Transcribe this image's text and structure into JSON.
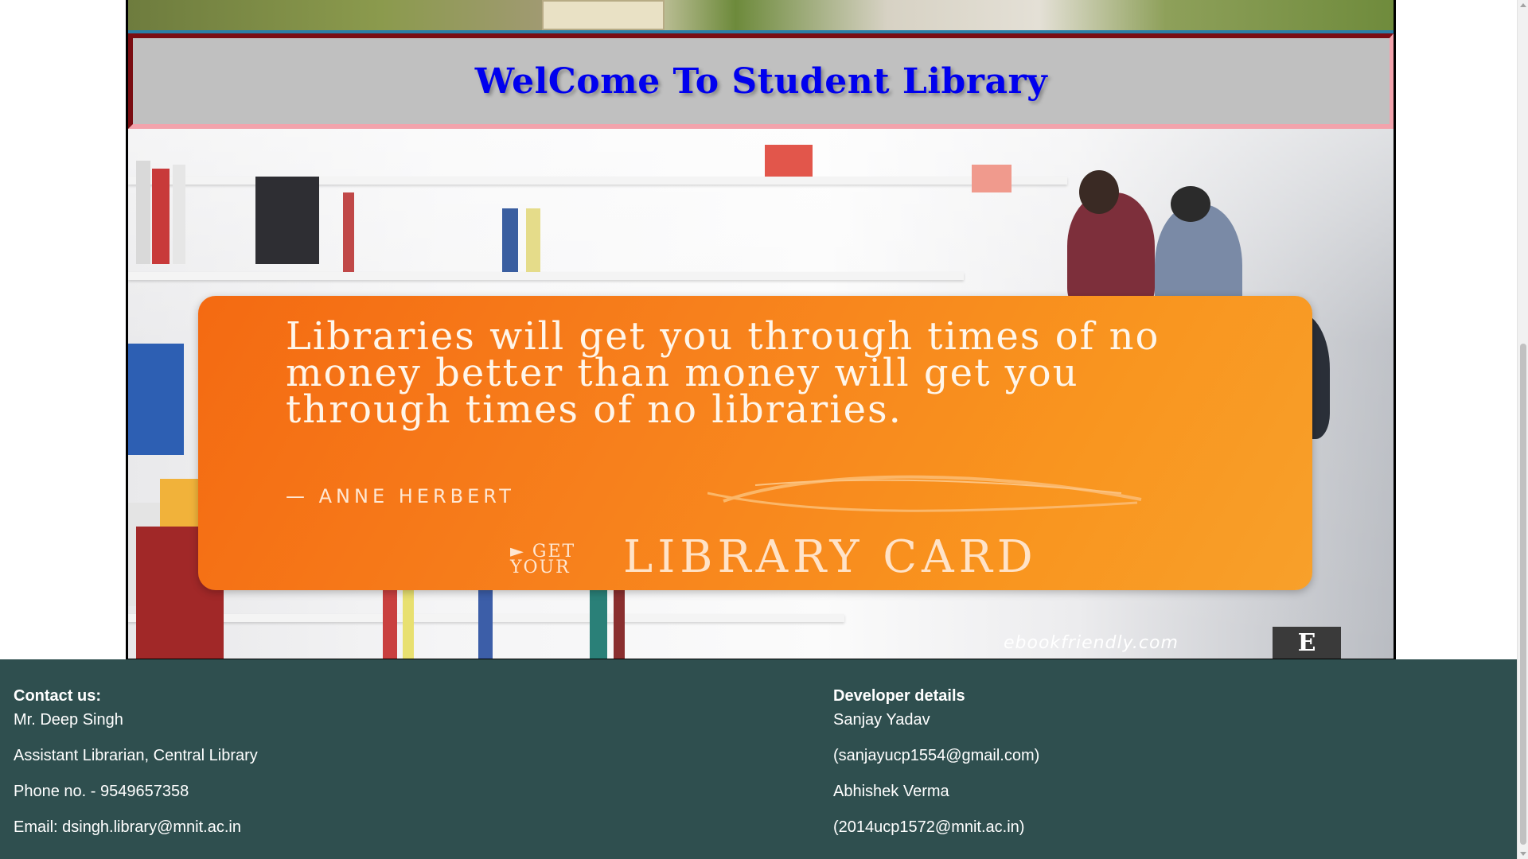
{
  "header": {
    "title": "WelCome To Student Library"
  },
  "poster": {
    "quote": "Libraries will get you through times of no money better than money will get you through times of no libraries.",
    "author": "— ANNE HERBERT",
    "cta_prefix_line1": "► GET",
    "cta_prefix_line2": "YOUR",
    "cta_main": "LIBRARY CARD",
    "site": "ebookfriendly.com",
    "logo_letter": "E"
  },
  "footer": {
    "contact": {
      "heading": "Contact us:",
      "lines": [
        "Mr. Deep Singh",
        "Assistant Librarian, Central Library",
        "Phone no. - 9549657358",
        "Email: dsingh.library@mnit.ac.in"
      ]
    },
    "developers": {
      "heading": "Developer details",
      "lines": [
        "Sanjay Yadav",
        "(sanjayucp1554@gmail.com)",
        "Abhishek Verma",
        "(2014ucp1572@mnit.ac.in)"
      ]
    }
  },
  "colors": {
    "title": "#0000ee",
    "banner_bg": "#c0c0c0",
    "footer_bg": "#2f4f4f",
    "card_orange": "#f7801c"
  }
}
